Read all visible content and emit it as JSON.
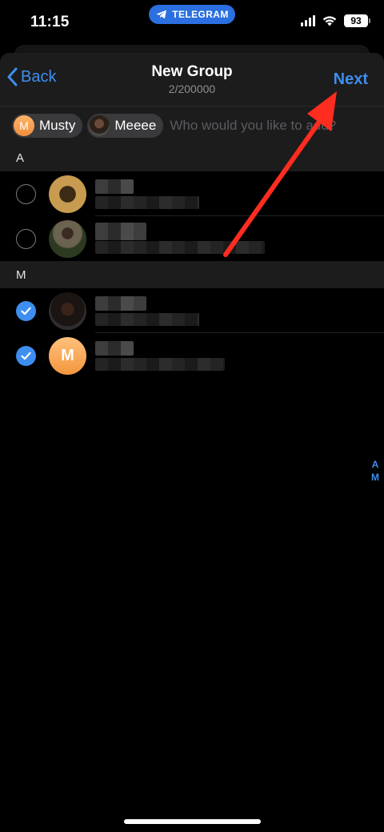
{
  "status_bar": {
    "time": "11:15",
    "app_pill": "TELEGRAM",
    "battery": "93"
  },
  "nav": {
    "back_label": "Back",
    "title": "New Group",
    "subtitle": "2/200000",
    "next_label": "Next"
  },
  "tokens": [
    {
      "label": "Musty",
      "avatar_letter": "M"
    },
    {
      "label": "Meeee"
    }
  ],
  "search": {
    "placeholder": "Who would you like to add?"
  },
  "sections": [
    {
      "letter": "A"
    },
    {
      "letter": "M"
    }
  ],
  "rows": [
    {
      "selected": false,
      "avatar": "photo"
    },
    {
      "selected": false,
      "avatar": "photo"
    },
    {
      "selected": true,
      "avatar": "photo"
    },
    {
      "selected": true,
      "avatar_letter": "M"
    }
  ],
  "index_letters": [
    "A",
    "M"
  ],
  "colors": {
    "accent": "#3e8eef",
    "annotation_arrow": "#ff2d1f",
    "header_bg": "#1c1c1d"
  }
}
